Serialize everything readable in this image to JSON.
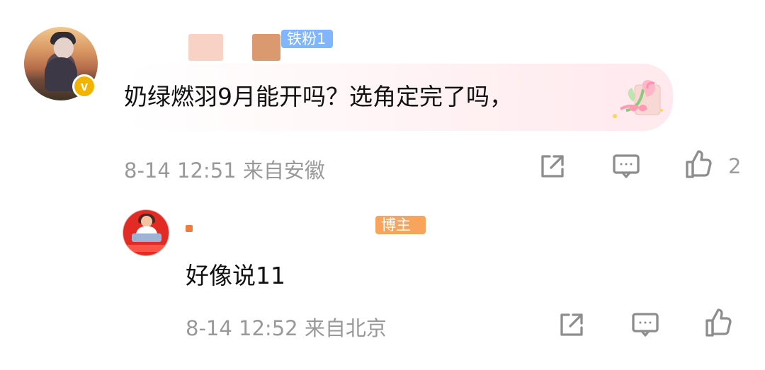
{
  "comments": [
    {
      "badge": "铁粉1",
      "text": "奶绿燃羽9月能开吗？选角定完了吗，",
      "meta": "8-14 12:51 来自安徽",
      "like_count": "2",
      "verified_mark": "v"
    },
    {
      "badge": "博主",
      "text": "好像说11",
      "meta": "8-14 12:52 来自北京"
    }
  ],
  "icons": {
    "share": "share-icon",
    "comment": "comment-icon",
    "like": "like-icon"
  },
  "colors": {
    "text": "#111111",
    "meta": "#999999",
    "fan_badge": "#7fb6ff",
    "author_badge": "#f9a45d",
    "verified": "#f3b400"
  }
}
